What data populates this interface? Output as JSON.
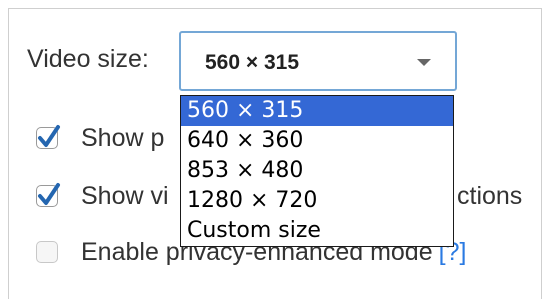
{
  "video_size": {
    "label": "Video size:",
    "selected_value": "560 × 315",
    "options": [
      "560 × 315",
      "640 × 360",
      "853 × 480",
      "1280 × 720",
      "Custom size"
    ],
    "selected_index": 0
  },
  "options": [
    {
      "label_visible": "Show p",
      "label_right": "",
      "checked": true
    },
    {
      "label_visible": "Show vi",
      "label_right": "ctions",
      "checked": true
    },
    {
      "label_visible": "Enable privacy-enhanced mode",
      "help": "[?]",
      "checked": false
    }
  ],
  "colors": {
    "select_border": "#74a7d6",
    "highlight": "#3468d5",
    "link": "#2a7ae2",
    "checkbox_check": "#2466b0"
  }
}
